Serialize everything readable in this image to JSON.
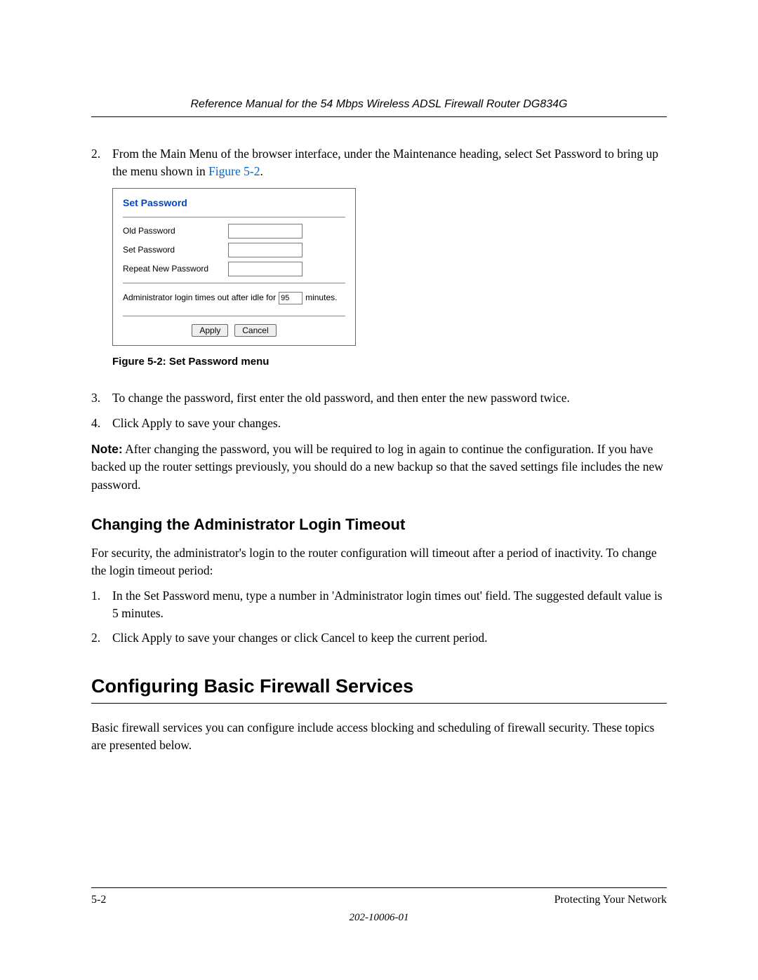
{
  "header": {
    "title": "Reference Manual for the 54 Mbps Wireless ADSL Firewall Router DG834G"
  },
  "step2": {
    "num": "2.",
    "text_a": "From the Main Menu of the browser interface, under the Maintenance heading, select Set Password to bring up the menu shown in ",
    "xref": "Figure 5-2",
    "text_b": "."
  },
  "figure": {
    "title": "Set Password",
    "old_label": "Old Password",
    "set_label": "Set Password",
    "repeat_label": "Repeat New Password",
    "idle_text_a": "Administrator login times out after idle for",
    "idle_value": "95",
    "idle_text_b": "minutes.",
    "apply": "Apply",
    "cancel": "Cancel"
  },
  "fig_caption": "Figure 5-2:  Set Password menu",
  "step3": {
    "num": "3.",
    "text": "To change the password, first enter the old password, and then enter the new password twice."
  },
  "step4": {
    "num": "4.",
    "text": "Click Apply to save your changes."
  },
  "note": {
    "label": "Note:",
    "text": " After changing the password, you will be required to log in again to continue the configuration. If you have backed up the router settings previously, you should do a new backup so that the saved settings file includes the new password."
  },
  "h2_timeout": "Changing the Administrator Login Timeout",
  "timeout_intro": "For security, the administrator's login to the router configuration will timeout after a period of inactivity. To change the login timeout period:",
  "timeout_step1": {
    "num": "1.",
    "text": "In the Set Password menu, type a number in 'Administrator login times out' field. The suggested default value is 5 minutes."
  },
  "timeout_step2": {
    "num": "2.",
    "text": "Click Apply to save your changes or click Cancel to keep the current period."
  },
  "h1_firewall": "Configuring Basic Firewall Services",
  "firewall_intro": "Basic firewall services you can configure include access blocking and scheduling of firewall security. These topics are presented below.",
  "footer": {
    "page": "5-2",
    "section": "Protecting Your Network",
    "doc": "202-10006-01"
  }
}
